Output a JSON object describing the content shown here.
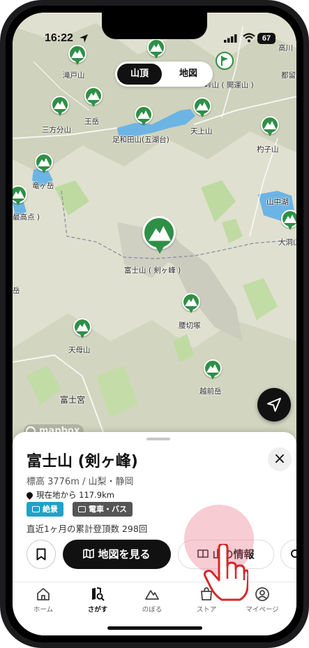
{
  "status_bar": {
    "time": "16:22",
    "battery": "67"
  },
  "map_toggle": {
    "peak_label": "山頂",
    "map_label": "地図"
  },
  "map_labels": {
    "takido": "滝戸山",
    "ootake": "王岳",
    "mitsutoge": "三方分山",
    "ashiwada": "足和田山(五湖台)",
    "tenjo": "天上山",
    "kaiun": "峠山 ( 開運山 )",
    "tsuru": "都留",
    "koshi": "杓子山",
    "takagawa": "高川",
    "ryugadake": "竜ヶ岳",
    "koshima": "最高点 )",
    "yamanakako": "山中湖",
    "ohorayama": "大洞山",
    "fuji": "富士山 ( 剣ヶ峰 )",
    "koshikiri": "腰切塚",
    "tenbo": "天母山",
    "echizen": "越前岳",
    "fujinomiya": "富士宮",
    "iwa": "岳"
  },
  "mapbox": {
    "label": "mapbox"
  },
  "sheet": {
    "title": "富士山 (剣ヶ峰)",
    "subtitle": "標高 3776m / 山梨・静岡",
    "distance": "現在地から 117.9km",
    "tag_scenic": "絶景",
    "tag_transit": "電車・バス",
    "climb_count": "直近1ヶ月の累計登頂数 298回",
    "close": "×",
    "map_button": "地図を見る",
    "info_button": "山の情報"
  },
  "tabs": [
    {
      "label": "ホーム"
    },
    {
      "label": "さがす"
    },
    {
      "label": "のぼる"
    },
    {
      "label": "ストア"
    },
    {
      "label": "マイページ"
    }
  ],
  "colors": {
    "accent": "#2f8f46",
    "lake": "#6cb4e4",
    "scenic_tag": "#1fa2c9"
  }
}
